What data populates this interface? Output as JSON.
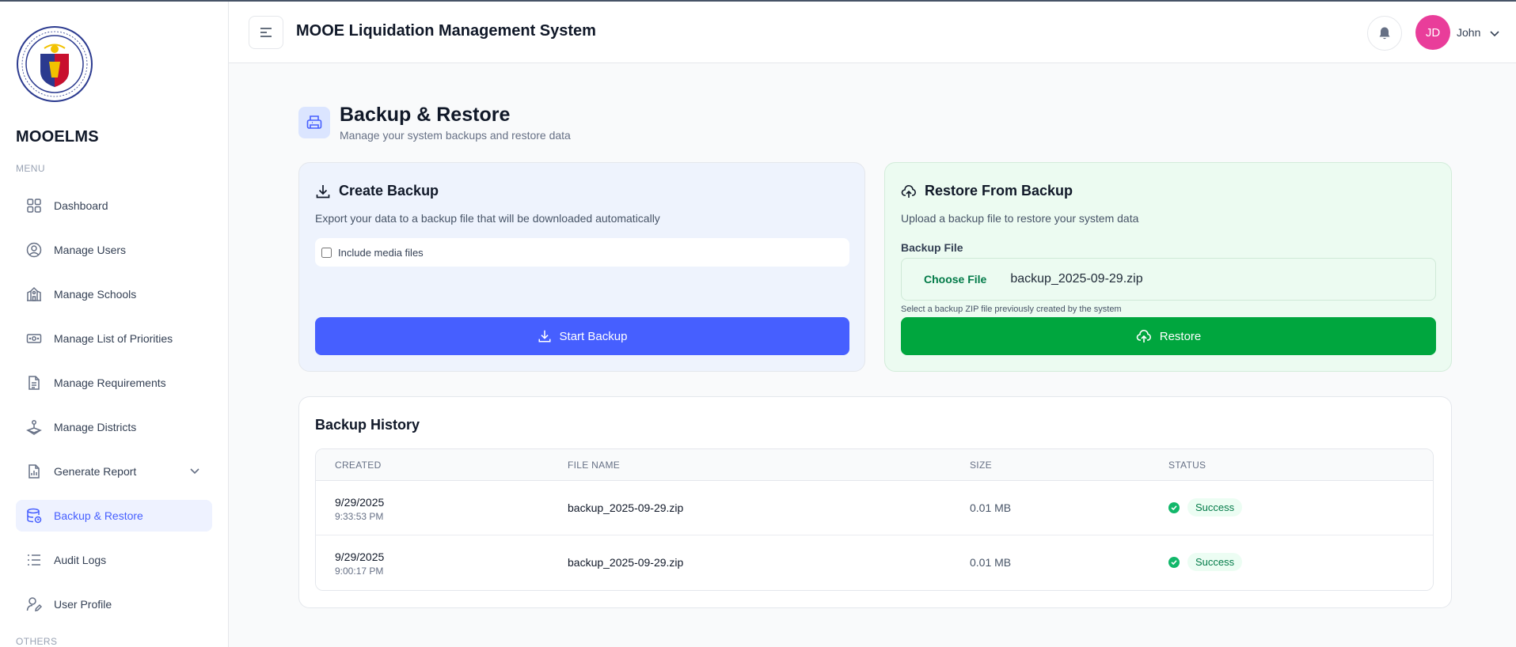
{
  "sidebar": {
    "brand": "MOOELMS",
    "menu_label": "MENU",
    "others_label": "OTHERS",
    "items": [
      {
        "label": "Dashboard",
        "icon": "grid-icon"
      },
      {
        "label": "Manage Users",
        "icon": "user-circle-icon"
      },
      {
        "label": "Manage Schools",
        "icon": "school-icon"
      },
      {
        "label": "Manage List of Priorities",
        "icon": "money-icon"
      },
      {
        "label": "Manage Requirements",
        "icon": "document-icon"
      },
      {
        "label": "Manage Districts",
        "icon": "districts-icon"
      },
      {
        "label": "Generate Report",
        "icon": "report-icon"
      },
      {
        "label": "Backup & Restore",
        "icon": "database-restore-icon",
        "active": true
      },
      {
        "label": "Audit Logs",
        "icon": "list-icon"
      },
      {
        "label": "User Profile",
        "icon": "user-edit-icon"
      }
    ]
  },
  "header": {
    "title": "MOOE Liquidation Management System",
    "user": {
      "initials": "JD",
      "name": "John",
      "avatar_color": "#e93d9a"
    }
  },
  "page": {
    "title": "Backup & Restore",
    "subtitle": "Manage your system backups and restore data"
  },
  "backup_card": {
    "title": "Create Backup",
    "description": "Export your data to a backup file that will be downloaded automatically",
    "checkbox_label": "Include media files",
    "checkbox_checked": false,
    "button_label": "Start Backup"
  },
  "restore_card": {
    "title": "Restore From Backup",
    "description": "Upload a backup file to restore your system data",
    "field_label": "Backup File",
    "choose_label": "Choose File",
    "file_name": "backup_2025-09-29.zip",
    "hint": "Select a backup ZIP file previously created by the system",
    "button_label": "Restore"
  },
  "history": {
    "title": "Backup History",
    "columns": [
      "CREATED",
      "FILE NAME",
      "SIZE",
      "STATUS"
    ],
    "rows": [
      {
        "date": "9/29/2025",
        "time": "9:33:53 PM",
        "file": "backup_2025-09-29.zip",
        "size": "0.01 MB",
        "status": "Success"
      },
      {
        "date": "9/29/2025",
        "time": "9:00:17 PM",
        "file": "backup_2025-09-29.zip",
        "size": "0.01 MB",
        "status": "Success"
      }
    ]
  },
  "colors": {
    "primary": "#465fff",
    "success": "#00a63e",
    "avatar": "#e93d9a"
  }
}
